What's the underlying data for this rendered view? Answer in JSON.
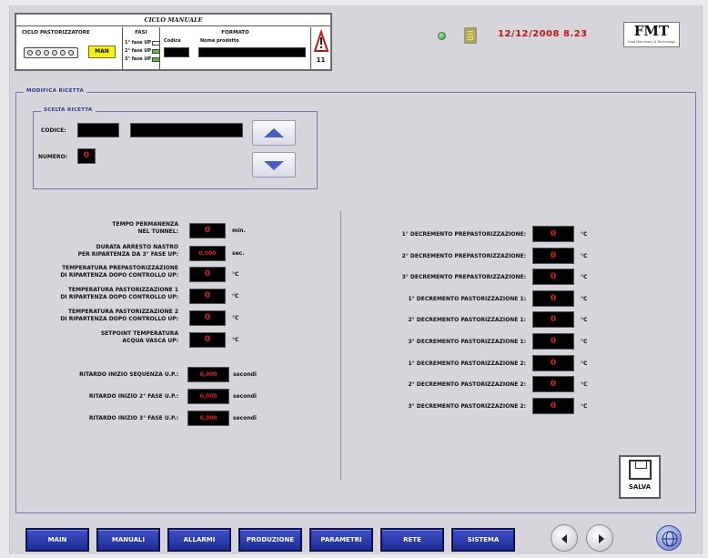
{
  "header": {
    "title": "CICLO MANUALE",
    "col_ciclo": "CICLO PASTORIZZATORE",
    "mode_button": "MAN",
    "col_fasi": "FASI",
    "phases": [
      {
        "label": "1° fase UP",
        "color": "#ffffff"
      },
      {
        "label": "2° fase UP",
        "color": "#5fb43c"
      },
      {
        "label": "3° fase UP",
        "color": "#5fb43c"
      }
    ],
    "col_formato": "FORMATO",
    "codice_label": "Codice",
    "nome_label": "Nome prodotto",
    "alarm_count": "11"
  },
  "status": {
    "led_color": "#2ebd2e",
    "datetime": "12/12/2008 8.23",
    "logo": "FMT",
    "logo_sub": "Food Machinery & Technology"
  },
  "section": {
    "title": "MODIFICA RICETTA"
  },
  "recipe_select": {
    "title": "SCELTA RICETTA",
    "codice_label": "CODICE:",
    "numero_label": "NUMERO:",
    "numero_value": "0",
    "up_arrow": "up-arrow",
    "down_arrow": "down-arrow"
  },
  "left_params": [
    {
      "label": "TEMPO PERMANENZA\nNEL TUNNEL:",
      "value": "0",
      "unit": "min."
    },
    {
      "label": "DURATA ARRESTO NASTRO\nPER RIPARTENZA DA 3° FASE UP:",
      "value": "0,000",
      "unit": "sec."
    },
    {
      "label": "TEMPERATURA PREPASTORIZZAZIONE\nDI RIPARTENZA DOPO CONTROLLO UP:",
      "value": "0",
      "unit": "°C"
    },
    {
      "label": "TEMPERATURA PASTORIZZAZIONE 1\nDI RIPARTENZA DOPO CONTROLLO UP:",
      "value": "0",
      "unit": "°C"
    },
    {
      "label": "TEMPERATURA PASTORIZZAZIONE 2\nDI RIPARTENZA DOPO CONTROLLO UP:",
      "value": "0",
      "unit": "°C"
    },
    {
      "label": "SETPOINT TEMPERATURA\nACQUA VASCA UP:",
      "value": "0",
      "unit": "°C"
    }
  ],
  "delays": [
    {
      "label": "RITARDO INIZIO SEQUENZA U.P.:",
      "value": "0,000",
      "unit": "secondi"
    },
    {
      "label": "RITARDO INIZIO 2° FASE U.P.:",
      "value": "0,000",
      "unit": "secondi"
    },
    {
      "label": "RITARDO INIZIO 3° FASE U.P.:",
      "value": "0,000",
      "unit": "secondi"
    }
  ],
  "right_params": [
    {
      "label": "1° DECREMENTO PREPASTORIZZAZIONE:",
      "value": "0",
      "unit": "°C"
    },
    {
      "label": "2° DECREMENTO PREPASTORIZZAZIONE:",
      "value": "0",
      "unit": "°C"
    },
    {
      "label": "3° DECREMENTO PREPASTORIZZAZIONE:",
      "value": "0",
      "unit": "°C"
    },
    {
      "label": "1° DECREMENTO PASTORIZZAZIONE 1:",
      "value": "0",
      "unit": "°C"
    },
    {
      "label": "2° DECREMENTO PASTORIZZAZIONE 1:",
      "value": "0",
      "unit": "°C"
    },
    {
      "label": "3° DECREMENTO PASTORIZZAZIONE 1:",
      "value": "0",
      "unit": "°C"
    },
    {
      "label": "1° DECREMENTO PASTORIZZAZIONE 2:",
      "value": "0",
      "unit": "°C"
    },
    {
      "label": "2° DECREMENTO PASTORIZZAZIONE 2:",
      "value": "0",
      "unit": "°C"
    },
    {
      "label": "3° DECREMENTO PASTORIZZAZIONE 2:",
      "value": "0",
      "unit": "°C"
    }
  ],
  "save_label": "SALVA",
  "nav": [
    "MAIN",
    "MANUALI",
    "ALLARMI",
    "PRODUZIONE",
    "PARAMETRI",
    "RETE",
    "SISTEMA"
  ],
  "icons": {
    "prev": "arrow-left-icon",
    "next": "arrow-right-icon",
    "globe": "globe-icon",
    "warning": "warning-triangle-icon",
    "save": "floppy-disk-icon"
  }
}
